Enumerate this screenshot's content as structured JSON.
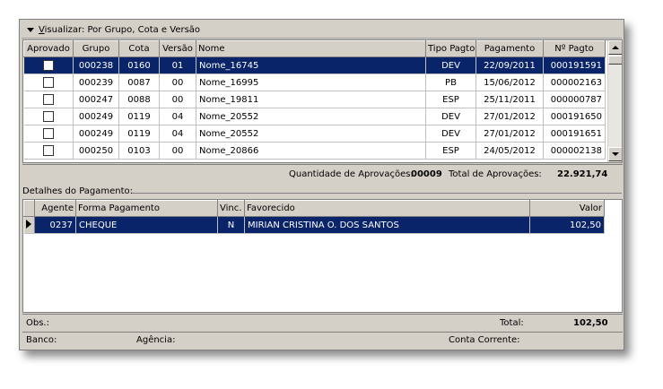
{
  "group_bar": {
    "prefix": "V",
    "rest": "isualizar: Por Grupo, Cota e Versão"
  },
  "payments_table": {
    "headers": {
      "aprovado": "Aprovado",
      "grupo": "Grupo",
      "cota": "Cota",
      "versao": "Versão",
      "nome": "Nome",
      "tipo": "Tipo Pagto",
      "pagamento": "Pagamento",
      "numero": "Nº Pagto"
    },
    "rows": [
      {
        "grupo": "000238",
        "cota": "0160",
        "versao": "01",
        "nome": "Nome_16745",
        "tipo": "DEV",
        "pagamento": "22/09/2011",
        "numero": "000191591",
        "selected": true
      },
      {
        "grupo": "000239",
        "cota": "0087",
        "versao": "00",
        "nome": "Nome_16995",
        "tipo": "PB",
        "pagamento": "15/06/2012",
        "numero": "000002163",
        "selected": false
      },
      {
        "grupo": "000247",
        "cota": "0088",
        "versao": "00",
        "nome": "Nome_19811",
        "tipo": "ESP",
        "pagamento": "25/11/2011",
        "numero": "000000787",
        "selected": false
      },
      {
        "grupo": "000249",
        "cota": "0119",
        "versao": "04",
        "nome": "Nome_20552",
        "tipo": "DEV",
        "pagamento": "27/01/2012",
        "numero": "000191650",
        "selected": false
      },
      {
        "grupo": "000249",
        "cota": "0119",
        "versao": "04",
        "nome": "Nome_20552",
        "tipo": "DEV",
        "pagamento": "27/01/2012",
        "numero": "000191651",
        "selected": false
      },
      {
        "grupo": "000250",
        "cota": "0103",
        "versao": "00",
        "nome": "Nome_20866",
        "tipo": "ESP",
        "pagamento": "24/05/2012",
        "numero": "000002138",
        "selected": false
      }
    ]
  },
  "summary": {
    "qtd_label": "Quantidade de Aprovações:",
    "qtd_value": "00009",
    "total_label": "Total de Aprovações:",
    "total_value": "22.921,74"
  },
  "details": {
    "section_label": "Detalhes do Pagamento:",
    "headers": {
      "agente": "Agente",
      "forma": "Forma Pagamento",
      "vinc": "Vinc.",
      "favorecido": "Favorecido",
      "valor": "Valor"
    },
    "rows": [
      {
        "agente": "0237",
        "forma": "CHEQUE",
        "vinc": "N",
        "favorecido": "MIRIAN CRISTINA O. DOS SANTOS",
        "valor": "102,50",
        "selected": true
      }
    ]
  },
  "footer": {
    "obs_label": "Obs.:",
    "total_label": "Total:",
    "total_value": "102,50",
    "banco_label": "Banco:",
    "agencia_label": "Agência:",
    "conta_label": "Conta Corrente:"
  },
  "colors": {
    "selection": "#0a246a",
    "panel": "#d4d0c8"
  }
}
